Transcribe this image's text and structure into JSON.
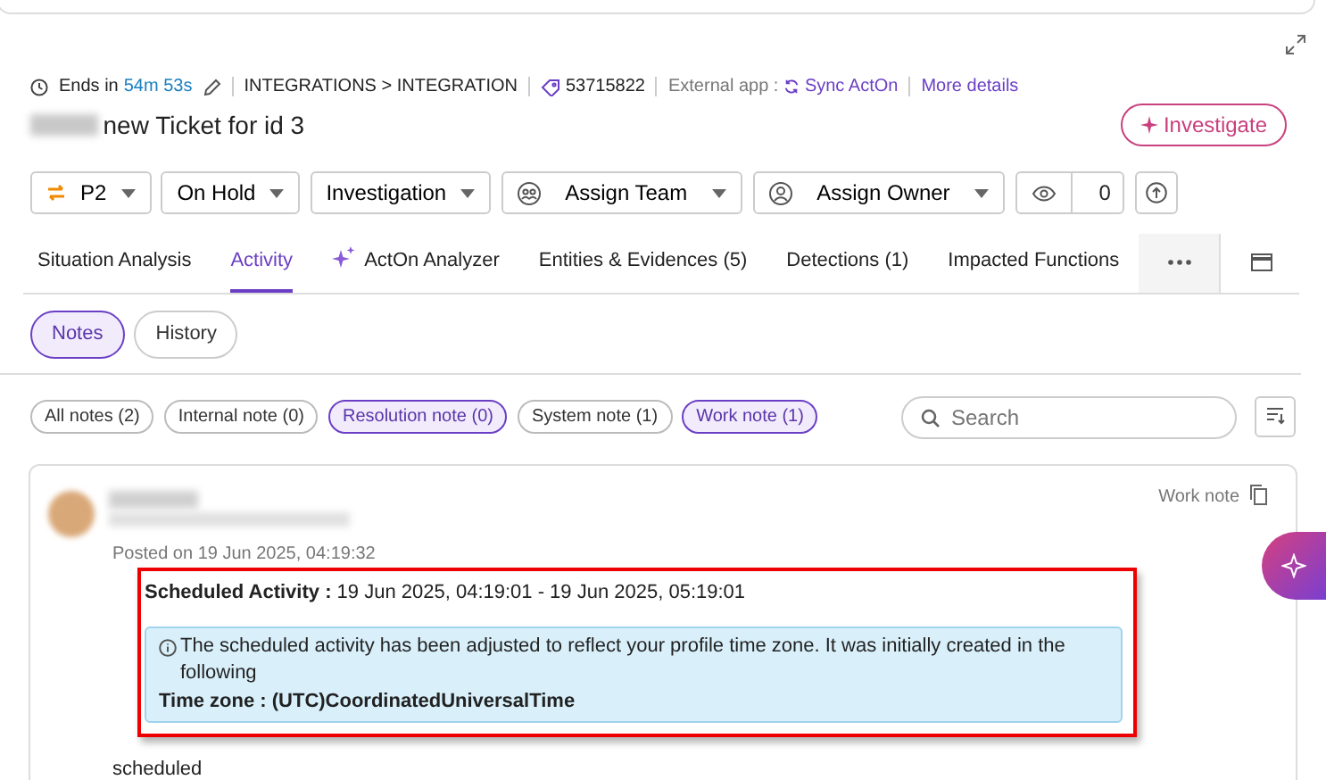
{
  "meta": {
    "ends_label": "Ends in",
    "ends_value": "54m 53s",
    "path": "INTEGRATIONS > INTEGRATION",
    "ticket_id": "53715822",
    "external_label": "External app :",
    "external_value": "Sync ActOn",
    "more": "More details"
  },
  "title": "new Ticket for id 3",
  "investigate": "Investigate",
  "dropdowns": [
    {
      "kind": "priority",
      "label": "P2"
    },
    {
      "kind": "plain",
      "label": "On Hold"
    },
    {
      "kind": "plain",
      "label": "Investigation"
    },
    {
      "kind": "team",
      "label": "Assign Team"
    },
    {
      "kind": "owner",
      "label": "Assign Owner"
    }
  ],
  "watchers": "0",
  "tabs": [
    {
      "label": "Situation Analysis",
      "selected": false
    },
    {
      "label": "Activity",
      "selected": true
    },
    {
      "label": "ActOn Analyzer",
      "selected": false,
      "kind": "ai"
    },
    {
      "label": "Entities & Evidences (5)",
      "selected": false
    },
    {
      "label": "Detections (1)",
      "selected": false
    },
    {
      "label": "Impacted Functions",
      "selected": false
    }
  ],
  "views": [
    {
      "label": "Notes",
      "selected": true
    },
    {
      "label": "History",
      "selected": false
    }
  ],
  "filters": [
    {
      "label": "All notes (2)",
      "selected": false
    },
    {
      "label": "Internal note (0)",
      "selected": false
    },
    {
      "label": "Resolution note (0)",
      "selected": true
    },
    {
      "label": "System note (1)",
      "selected": false
    },
    {
      "label": "Work note (1)",
      "selected": true
    }
  ],
  "search": {
    "placeholder": "Search"
  },
  "note": {
    "type": "Work note",
    "posted": "Posted on 19 Jun 2025, 04:19:32",
    "sched_label": "Scheduled Activity :",
    "sched_value": "19 Jun 2025, 04:19:01 - 19 Jun 2025, 05:19:01",
    "info": "The scheduled activity has been adjusted to reflect your profile time zone. It was initially created in the following",
    "tz": "Time zone : (UTC)CoordinatedUniversalTime",
    "body": "scheduled"
  }
}
